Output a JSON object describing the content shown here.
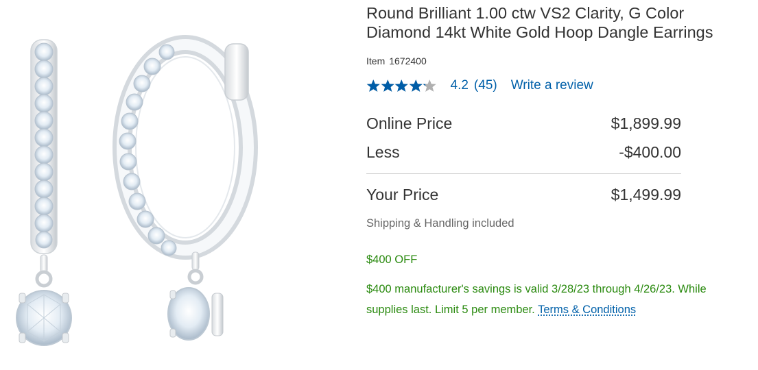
{
  "product": {
    "title": "Round Brilliant 1.00 ctw VS2 Clarity, G Color Diamond 14kt White Gold Hoop Dangle Earrings",
    "item_label": "Item",
    "item_number": "1672400",
    "image_alt": "Diamond hoop dangle earrings"
  },
  "rating": {
    "value": "4.2",
    "value_numeric": 4.2,
    "max": 5,
    "count": "(45)",
    "write_review": "Write a review",
    "star_color": "#005da7",
    "star_empty_color": "#b0b0b0"
  },
  "pricing": {
    "online_label": "Online Price",
    "online_value": "$1,899.99",
    "less_label": "Less",
    "less_value": "-$400.00",
    "your_label": "Your Price",
    "your_value": "$1,499.99",
    "shipping": "Shipping & Handling included"
  },
  "promo": {
    "badge": "$400 OFF",
    "text": "$400 manufacturer's savings is valid 3/28/23 through 4/26/23. While supplies last. Limit 5 per member.",
    "terms_link": "Terms & Conditions",
    "color": "#2a8a0f"
  },
  "colors": {
    "link": "#0060a9",
    "text": "#333333",
    "muted": "#666666"
  }
}
